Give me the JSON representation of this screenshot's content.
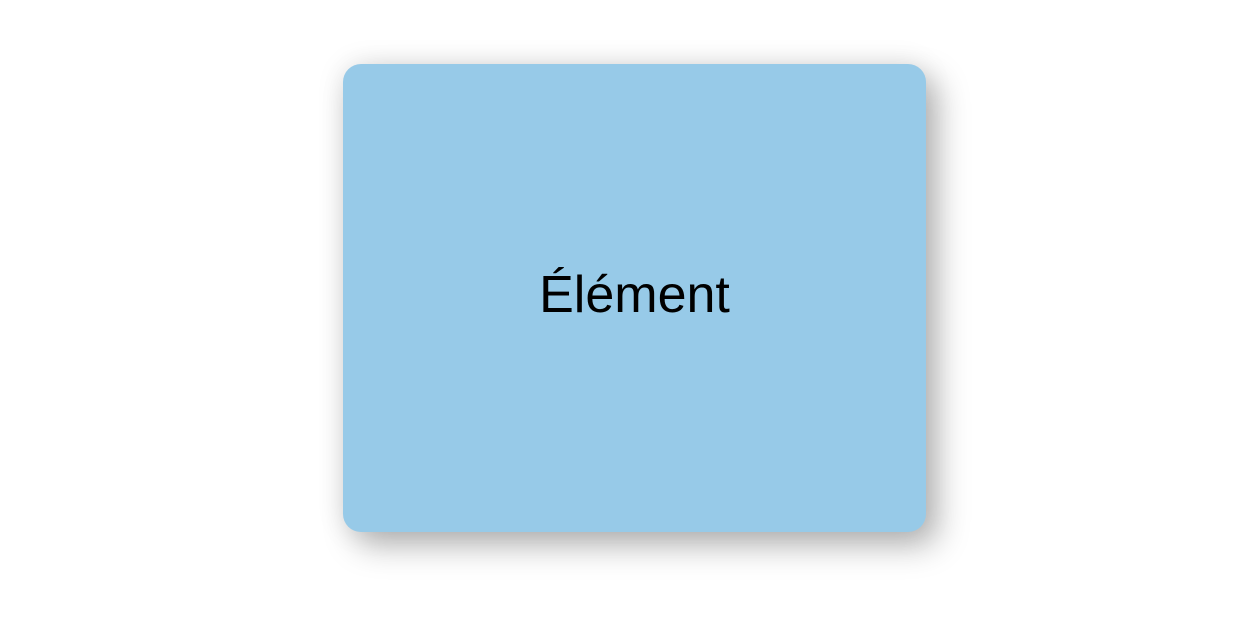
{
  "card": {
    "label": "Élément",
    "background_color": "#97cae8",
    "text_color": "#000000"
  },
  "page": {
    "background_color": "#ffffff"
  }
}
